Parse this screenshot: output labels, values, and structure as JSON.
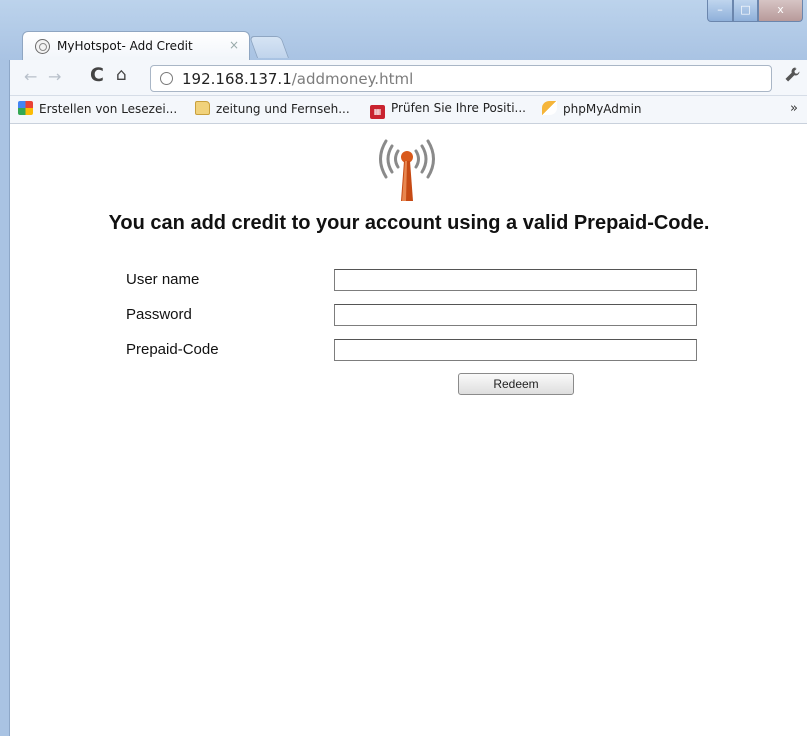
{
  "browser": {
    "tab_title": "MyHotspot- Add Credit",
    "tab_close": "×",
    "window_controls": {
      "minimize": "–",
      "maximize": "□",
      "close": "x"
    },
    "toolbar": {
      "back_icon": "←",
      "forward_icon": "→",
      "reload_icon": "C",
      "home_icon": "⌂",
      "wrench_icon": "🔧"
    },
    "address": {
      "host": "192.168.137.1",
      "path": "/addmoney.html"
    },
    "bookmarks": [
      {
        "label": "Erstellen von Lesezei...",
        "icon": "apps-icon"
      },
      {
        "label": "zeitung und Fernseh...",
        "icon": "folder-icon"
      },
      {
        "label": "Prüfen Sie Ihre Positi...",
        "icon": "check-icon"
      },
      {
        "label": "phpMyAdmin",
        "icon": "phpmyadmin-icon"
      }
    ],
    "bookmarks_more": "»"
  },
  "page": {
    "logo_icon": "wireless-tower-icon",
    "heading": "You can add credit to your account using a valid Prepaid-Code.",
    "form": {
      "username_label": "User name",
      "password_label": "Password",
      "prepaid_label": "Prepaid-Code",
      "username_value": "",
      "password_value": "",
      "prepaid_value": "",
      "submit_label": "Redeem"
    }
  },
  "colors": {
    "frame": "#a9c3e3",
    "logo_orange": "#d9591b",
    "logo_waves": "#8a8a8a"
  }
}
